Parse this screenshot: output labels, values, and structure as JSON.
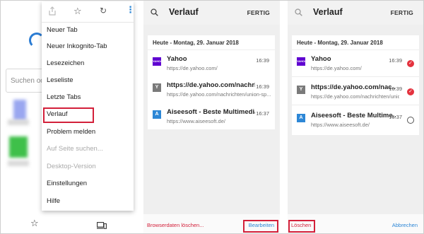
{
  "panel1": {
    "search_placeholder": "Suchen ode",
    "toolbar_icons": [
      "share-icon",
      "star-icon",
      "refresh-icon",
      "more-vert-icon"
    ],
    "menu_items": [
      {
        "label": "Neuer Tab",
        "enabled": true
      },
      {
        "label": "Neuer Inkognito-Tab",
        "enabled": true
      },
      {
        "label": "Lesezeichen",
        "enabled": true
      },
      {
        "label": "Leseliste",
        "enabled": true
      },
      {
        "label": "Letzte Tabs",
        "enabled": true
      },
      {
        "label": "Verlauf",
        "enabled": true,
        "highlighted": true
      },
      {
        "label": "Problem melden",
        "enabled": true
      },
      {
        "label": "Auf Seite suchen...",
        "enabled": false
      },
      {
        "label": "Desktop-Version",
        "enabled": false
      },
      {
        "label": "Einstellungen",
        "enabled": true
      },
      {
        "label": "Hilfe",
        "enabled": true
      }
    ],
    "bottom_icons": [
      "star-outline-icon",
      "devices-icon"
    ]
  },
  "history_header": {
    "title": "Verlauf",
    "done_label": "FERTIG"
  },
  "history": {
    "date_header": "Heute - Montag, 29. Januar 2018",
    "entries": [
      {
        "title": "Yahoo",
        "url": "https://de.yahoo.com/",
        "time": "16:39",
        "favicon_letter": "",
        "favicon_color": "#5f01d1"
      },
      {
        "title": "https://de.yahoo.com/nachricht...",
        "url": "https://de.yahoo.com/nachrichten/union-sp...",
        "time": "16:39",
        "favicon_letter": "Y",
        "favicon_color": "#7a7a7a"
      },
      {
        "title": "Aiseesoft - Beste Multimedia, M...",
        "url": "https://www.aiseesoft.de/",
        "time": "16:37",
        "favicon_letter": "A",
        "favicon_color": "#2d87d6"
      }
    ],
    "entries_edit": [
      {
        "title": "Yahoo",
        "url": "https://de.yahoo.com/",
        "time": "16:39",
        "selected": true
      },
      {
        "title": "https://de.yahoo.com/nac...",
        "url": "https://de.yahoo.com/nachrichten/union-...",
        "time": "16:39",
        "selected": true
      },
      {
        "title": "Aiseesoft - Beste Multime...",
        "url": "https://www.aiseesoft.de/",
        "time": "16:37",
        "selected": false
      }
    ]
  },
  "panel2_bottom": {
    "clear_label": "Browserdaten löschen...",
    "edit_label": "Bearbeiten"
  },
  "panel3_bottom": {
    "delete_label": "Löschen",
    "cancel_label": "Abbrechen"
  },
  "colors": {
    "accent_red": "#d3203a",
    "link_blue": "#2d87d6",
    "check_red": "#e4323e"
  }
}
